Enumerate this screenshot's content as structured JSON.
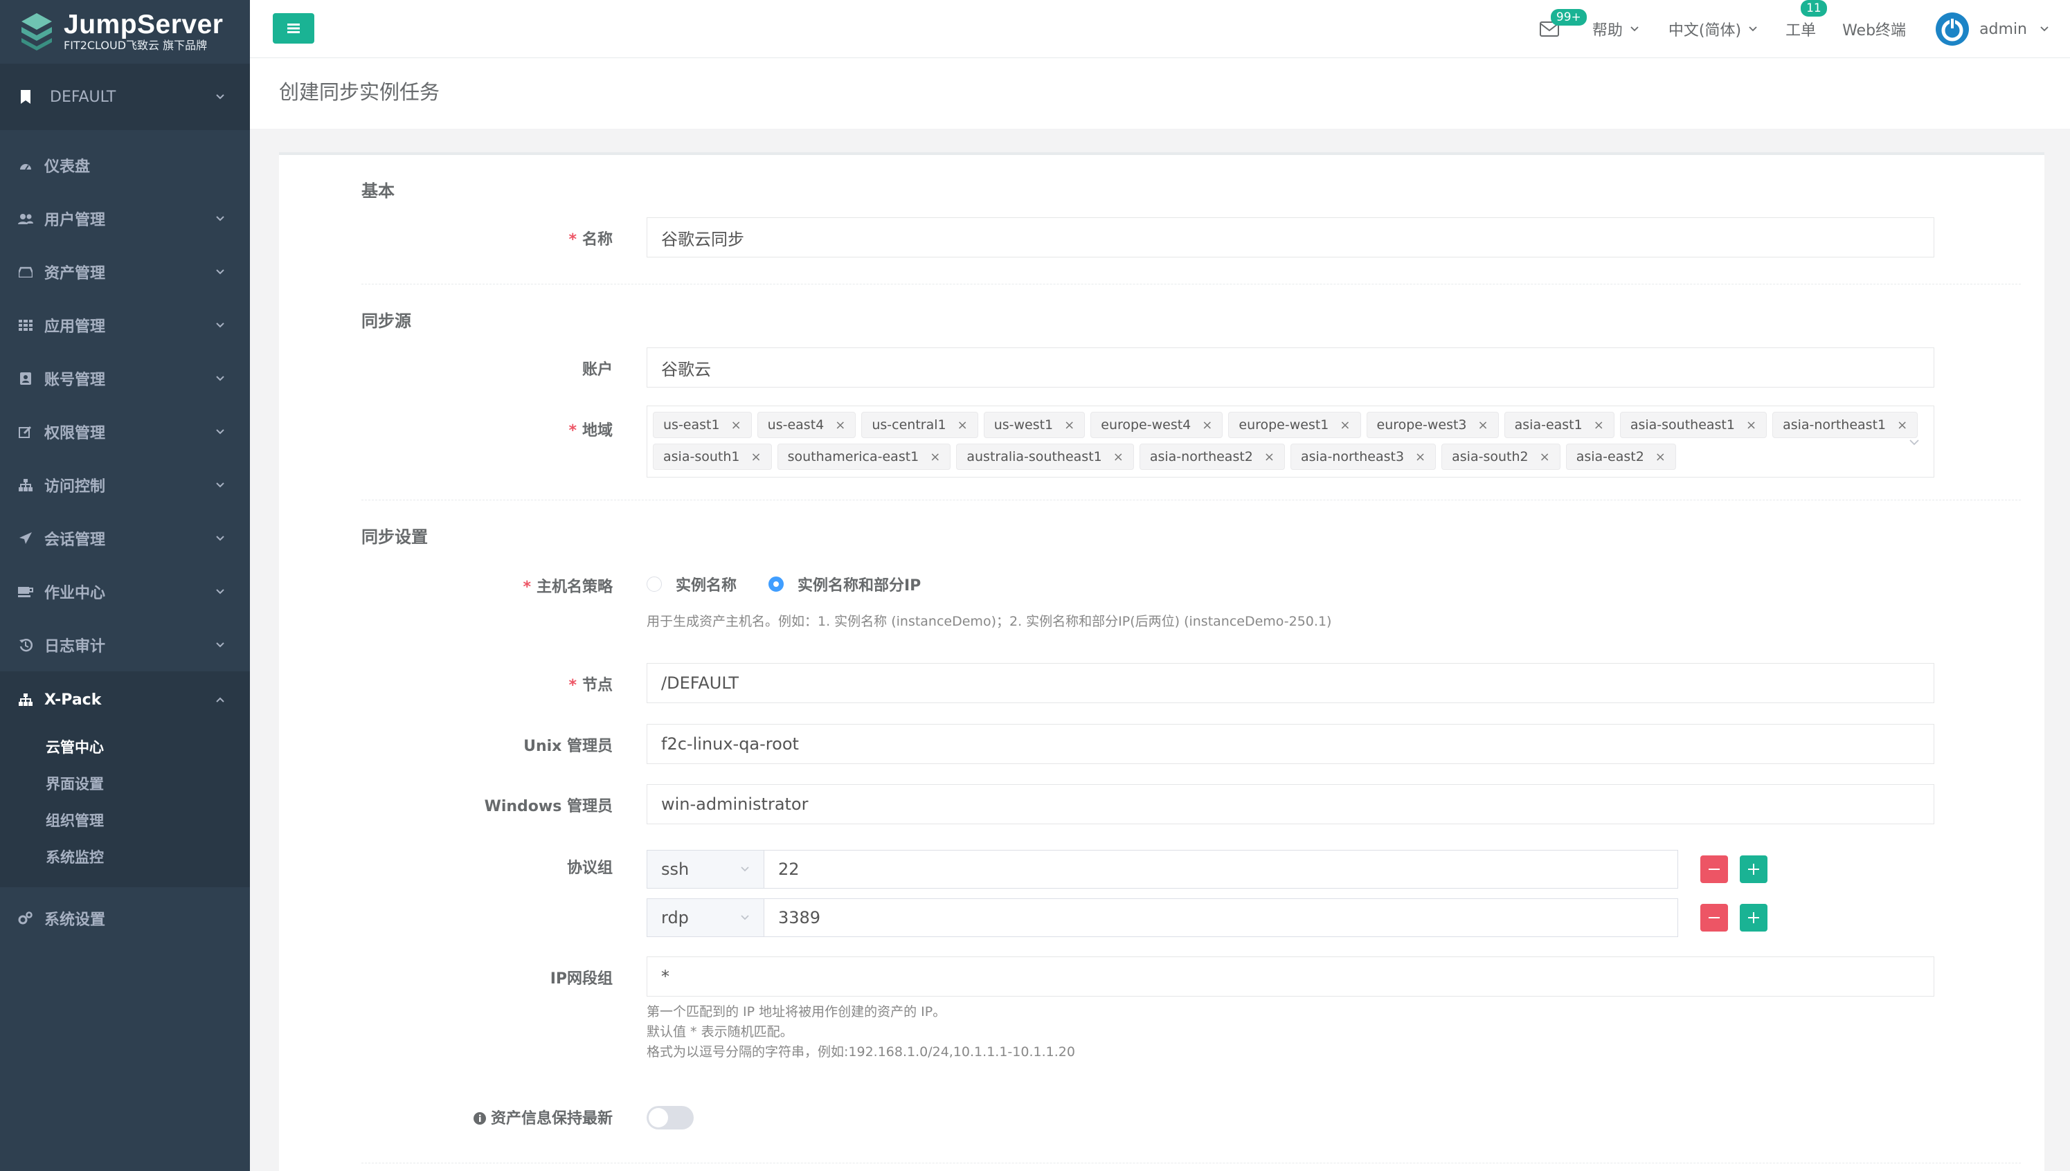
{
  "brand": {
    "title": "JumpServer",
    "subtitle": "FIT2CLOUD飞致云 旗下品牌"
  },
  "org": {
    "label": "DEFAULT"
  },
  "menu": {
    "dashboard": "仪表盘",
    "users": "用户管理",
    "assets": "资产管理",
    "apps": "应用管理",
    "accounts": "账号管理",
    "perms": "权限管理",
    "acl": "访问控制",
    "sessions": "会话管理",
    "ops": "作业中心",
    "audits": "日志审计",
    "xpack": "X-Pack",
    "xpack_items": [
      "云管中心",
      "界面设置",
      "组织管理",
      "系统监控"
    ],
    "settings": "系统设置"
  },
  "topbar": {
    "mail_badge": "99+",
    "help": "帮助",
    "language": "中文(简体)",
    "tickets": "工单",
    "tickets_badge": "11",
    "web_terminal": "Web终端",
    "user": "admin"
  },
  "page": {
    "title": "创建同步实例任务"
  },
  "form": {
    "section_basic": "基本",
    "name_label": "名称",
    "name_value": "谷歌云同步",
    "section_source": "同步源",
    "account_label": "账户",
    "account_value": "谷歌云",
    "regions_label": "地域",
    "regions": [
      [
        "us-east1",
        "us-east4",
        "us-central1",
        "us-west1",
        "europe-west4",
        "europe-west1",
        "europe-west3",
        "asia-east1",
        "asia-southeast1",
        "asia-northeast1"
      ],
      [
        "asia-south1",
        "southamerica-east1",
        "australia-southeast1",
        "asia-northeast2",
        "asia-northeast3",
        "asia-south2",
        "asia-east2"
      ]
    ],
    "section_settings": "同步设置",
    "hostname_label": "主机名策略",
    "hostname_opt1": "实例名称",
    "hostname_opt2": "实例名称和部分IP",
    "hostname_selected": "实例名称和部分IP",
    "hostname_help": "用于生成资产主机名。例如：1. 实例名称 (instanceDemo)；2. 实例名称和部分IP(后两位) (instanceDemo-250.1)",
    "node_label": "节点",
    "node_value": "/DEFAULT",
    "unix_label": "Unix 管理员",
    "unix_value": "f2c-linux-qa-root",
    "windows_label": "Windows 管理员",
    "windows_value": "win-administrator",
    "protocols_label": "协议组",
    "protocols": [
      {
        "name": "ssh",
        "port": "22"
      },
      {
        "name": "rdp",
        "port": "3389"
      }
    ],
    "ip_label": "IP网段组",
    "ip_value": "*",
    "ip_help": [
      "第一个匹配到的 IP 地址将被用作创建的资产的 IP。",
      "默认值 * 表示随机匹配。",
      "格式为以逗号分隔的字符串，例如:192.168.1.0/24,10.1.1.1-10.1.1.20"
    ],
    "keep_latest_label": "资产信息保持最新",
    "keep_latest_on": false
  },
  "colors": {
    "sidebar": "#2f4050",
    "accent": "#1ab394",
    "danger": "#ed5565",
    "radio": "#409eff"
  }
}
